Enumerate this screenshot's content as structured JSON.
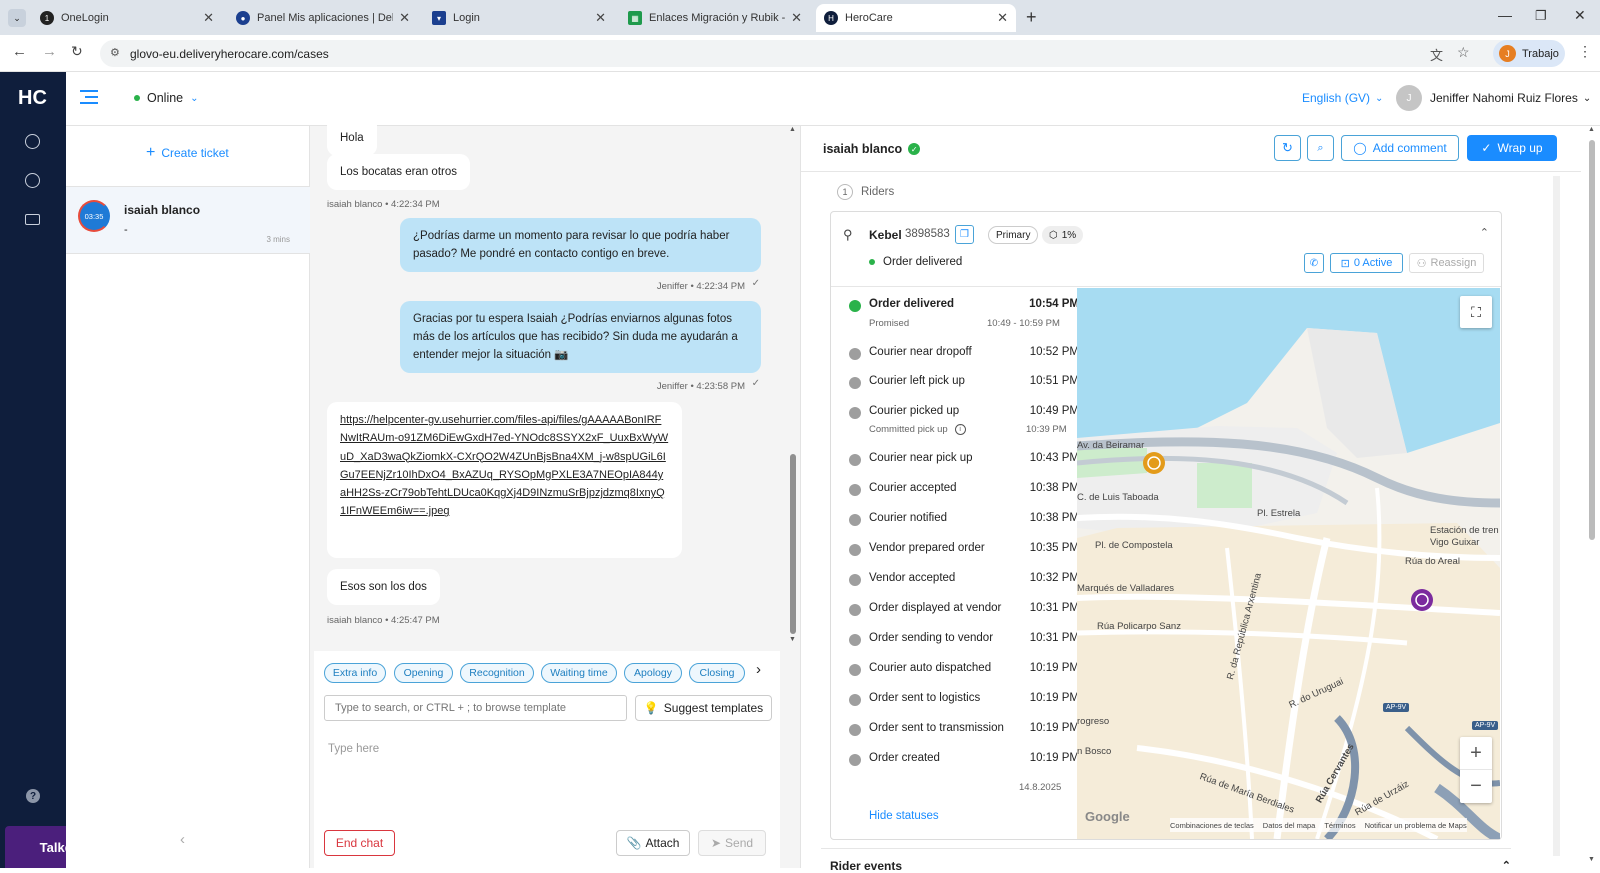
{
  "browser": {
    "tabs": [
      {
        "label": "OneLogin",
        "active": false
      },
      {
        "label": "Panel Mis aplicaciones | Deliver",
        "active": false
      },
      {
        "label": "Login",
        "active": false
      },
      {
        "label": "Enlaces Migración y Rubik - Go",
        "active": false
      },
      {
        "label": "HeroCare",
        "active": true
      }
    ],
    "url": "glovo-eu.deliveryherocare.com/cases",
    "profile": "Trabajo"
  },
  "app": {
    "logo": "HC",
    "status": "Online",
    "language": "English (GV)",
    "user_initial": "J",
    "user_name": "Jeniffer Nahomi Ruiz Flores",
    "talkdesk": "Talkdesk"
  },
  "cases": {
    "create_ticket": "Create ticket",
    "items": [
      {
        "name": "isaiah blanco",
        "preview": "-",
        "timer": "03:35",
        "age": "3 mins"
      }
    ]
  },
  "chat": {
    "messages": [
      {
        "text": "Hola"
      },
      {
        "text": "Los bocatas eran otros",
        "meta": "isaiah blanco • 4:22:34 PM"
      },
      {
        "text": "¿Podrías darme un momento para revisar lo que podría haber pasado? Me pondré en contacto contigo en breve.",
        "meta": "Jeniffer • 4:22:34 PM"
      },
      {
        "text": "Gracias por tu espera Isaiah ¿Podrías enviarnos algunas fotos más de los artículos que has recibido? Sin duda me ayudarán a entender mejor la situación 📷",
        "meta": "Jeniffer • 4:23:58 PM"
      },
      {
        "text": "https://helpcenter-gv.usehurrier.com/files-api/files/gAAAAABonIRFNwItRAUm-o91ZM6DiEwGxdH7ed-YNOdc8SSYX2xF_UuxBxWyWuD_XaD3waQkZiomkX-CXrQO2W4ZUnBjsBna4XM_j-w8spUGiL6IGu7EENjZr10IhDxO4_BxAZUq_RYSOpMgPXLE3A7NEOpIA844yaHH2Ss-zCr79obTehtLDUca0KqgXj4D9INzmuSrBjpzjdzmq8IxnyQ1IFnWEEm6iw==.jpeg"
      },
      {
        "text": "Esos son los dos",
        "meta": "isaiah blanco • 4:25:47 PM"
      }
    ],
    "chips": [
      "Extra info",
      "Opening",
      "Recognition",
      "Waiting time",
      "Apology",
      "Closing"
    ],
    "search_placeholder": "Type to search, or CTRL + ; to browse template",
    "suggest": "Suggest templates",
    "type_placeholder": "Type here",
    "end_chat": "End chat",
    "attach": "Attach",
    "send": "Send"
  },
  "panel": {
    "customer": "isaiah blanco",
    "add_comment": "Add comment",
    "wrap_up": "Wrap up",
    "riders_count": "1",
    "riders_label": "Riders",
    "rider": {
      "name": "Kebel",
      "id": "3898583",
      "tag": "Primary",
      "pct": "1%",
      "state": "Order delivered",
      "active": "0 Active",
      "reassign": "Reassign"
    },
    "statuses": [
      {
        "label": "Order delivered",
        "time": "10:54 PM",
        "sub": "Promised",
        "subtime": "10:49 - 10:59 PM",
        "done": true
      },
      {
        "label": "Courier near dropoff",
        "time": "10:52 PM"
      },
      {
        "label": "Courier left pick up",
        "time": "10:51 PM"
      },
      {
        "label": "Courier picked up",
        "time": "10:49 PM",
        "sub": "Committed pick up",
        "subtime": "10:39 PM"
      },
      {
        "label": "Courier near pick up",
        "time": "10:43 PM"
      },
      {
        "label": "Courier accepted",
        "time": "10:38 PM"
      },
      {
        "label": "Courier notified",
        "time": "10:38 PM"
      },
      {
        "label": "Vendor prepared order",
        "time": "10:35 PM"
      },
      {
        "label": "Vendor accepted",
        "time": "10:32 PM"
      },
      {
        "label": "Order displayed at vendor",
        "time": "10:31 PM"
      },
      {
        "label": "Order sending to vendor",
        "time": "10:31 PM"
      },
      {
        "label": "Courier auto dispatched",
        "time": "10:19 PM"
      },
      {
        "label": "Order sent to logistics",
        "time": "10:19 PM"
      },
      {
        "label": "Order sent to transmission",
        "time": "10:19 PM"
      },
      {
        "label": "Order created",
        "time": "10:19 PM",
        "date": "14.8.2025"
      }
    ],
    "hide_statuses": "Hide statuses",
    "rider_events": "Rider events"
  },
  "map": {
    "labels": [
      "Av. da Beiramar",
      "C. de Luis Taboada",
      "Pl. Estrela",
      "Pl. de Compostela",
      "Estación de tren Vigo Guixar",
      "Rúa do Areal",
      "Marqués de Valladares",
      "Rúa Policarpo Sanz",
      "R. da República Arxentina",
      "R. do Uruguai",
      "Rúa Cervantes",
      "Rúa de María Berdiales",
      "Rúa de Urzáiz",
      "rogreso",
      "n Bosco",
      "AP-9V",
      "AP-9V"
    ],
    "footer": [
      "Combinaciones de teclas",
      "Datos del mapa",
      "Términos",
      "Notificar un problema de Maps"
    ],
    "brand": "Google"
  },
  "colors": {
    "nav": "#0f1e3c",
    "accent": "#1a8cff",
    "bubble_out": "#bde3f7",
    "green": "#2ab24a",
    "danger": "#d9363e"
  }
}
